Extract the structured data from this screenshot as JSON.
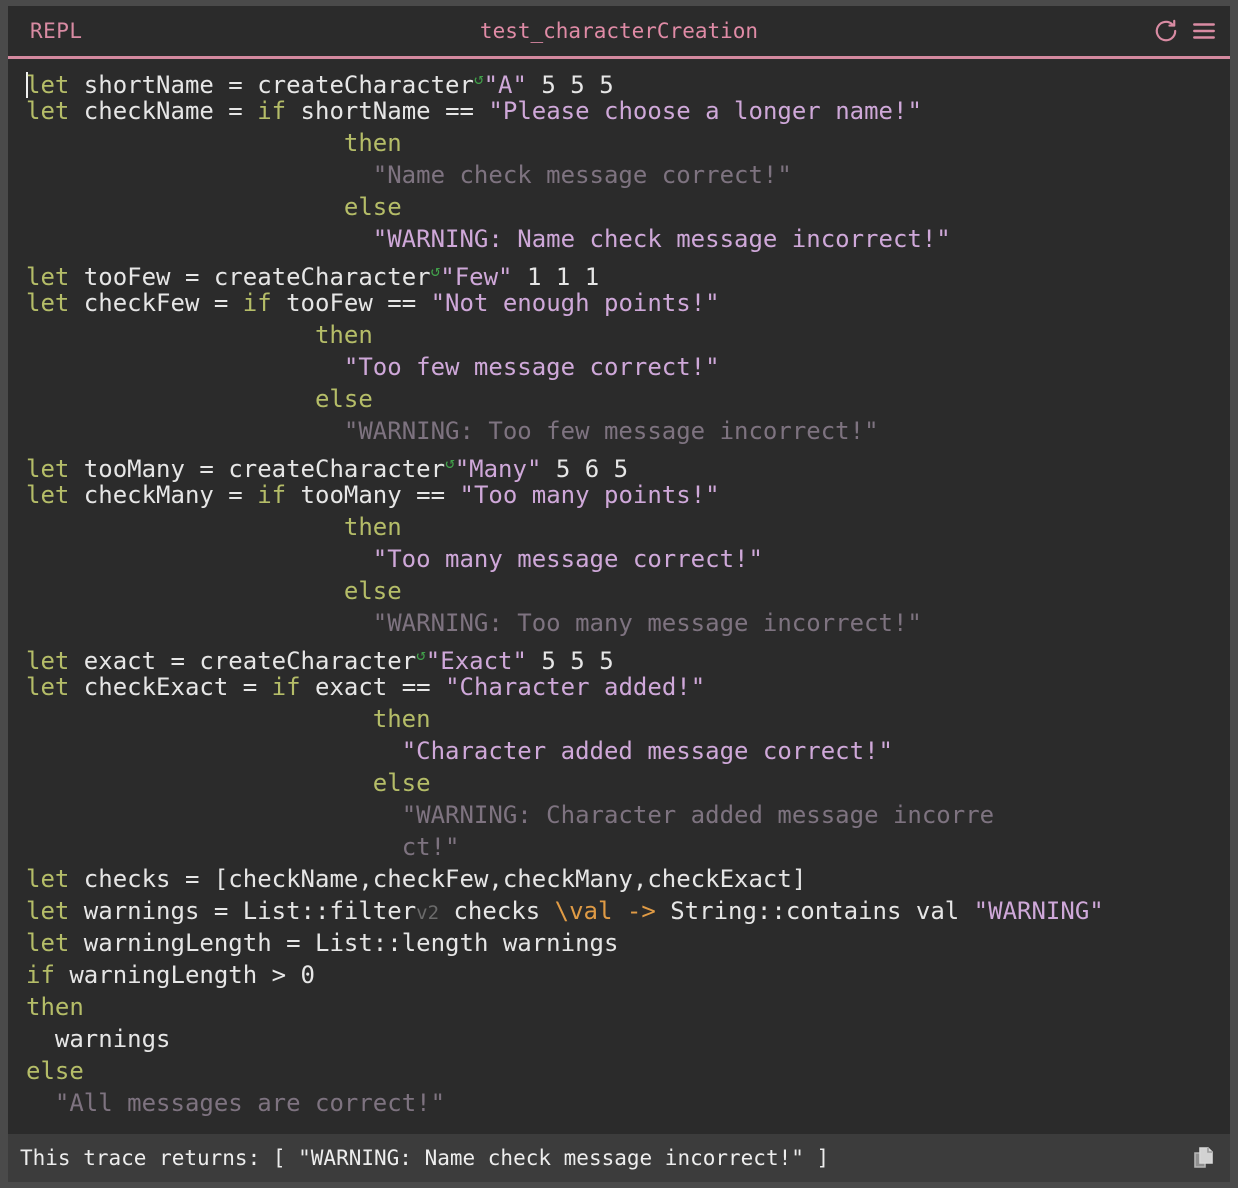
{
  "window": {
    "left_label": "REPL",
    "title": "test_characterCreation",
    "refresh_icon": "refresh-icon",
    "menu_icon": "hamburger-menu-icon",
    "accent_color": "#d98ba3",
    "background_color": "#2b2b2b",
    "frame_color": "#4a4a4a"
  },
  "editor": {
    "language": "roc",
    "caret_visible": true,
    "lines": [
      {
        "indent": 0,
        "tokens": [
          {
            "t": "caret"
          },
          {
            "t": "kw",
            "v": "let"
          },
          {
            "t": "id",
            "v": " shortName = "
          },
          {
            "t": "id",
            "v": "createCharacter"
          },
          {
            "t": "marker",
            "v": "↺"
          },
          {
            "t": "str",
            "v": "\"A\""
          },
          {
            "t": "id",
            "v": " 5 5 5"
          }
        ]
      },
      {
        "indent": 0,
        "tokens": [
          {
            "t": "kw",
            "v": "let"
          },
          {
            "t": "id",
            "v": " checkName = "
          },
          {
            "t": "kw",
            "v": "if"
          },
          {
            "t": "id",
            "v": " shortName "
          },
          {
            "t": "id",
            "v": "=="
          },
          {
            "t": "id",
            "v": " "
          },
          {
            "t": "str",
            "v": "\"Please choose a longer name!\""
          }
        ]
      },
      {
        "indent": 11,
        "tokens": [
          {
            "t": "kw",
            "v": "then"
          }
        ]
      },
      {
        "indent": 12,
        "tokens": [
          {
            "t": "strdim",
            "v": "\"Name check message correct!\""
          }
        ]
      },
      {
        "indent": 11,
        "tokens": [
          {
            "t": "kw",
            "v": "else"
          }
        ]
      },
      {
        "indent": 12,
        "tokens": [
          {
            "t": "str",
            "v": "\"WARNING: Name check message incorrect!\""
          }
        ]
      },
      {
        "indent": 0,
        "tokens": [
          {
            "t": "kw",
            "v": "let"
          },
          {
            "t": "id",
            "v": " tooFew = "
          },
          {
            "t": "id",
            "v": "createCharacter"
          },
          {
            "t": "marker",
            "v": "↺"
          },
          {
            "t": "str",
            "v": "\"Few\""
          },
          {
            "t": "id",
            "v": " 1 1 1"
          }
        ]
      },
      {
        "indent": 0,
        "tokens": [
          {
            "t": "kw",
            "v": "let"
          },
          {
            "t": "id",
            "v": " checkFew = "
          },
          {
            "t": "kw",
            "v": "if"
          },
          {
            "t": "id",
            "v": " tooFew "
          },
          {
            "t": "id",
            "v": "=="
          },
          {
            "t": "id",
            "v": " "
          },
          {
            "t": "str",
            "v": "\"Not enough points!\""
          }
        ]
      },
      {
        "indent": 10,
        "tokens": [
          {
            "t": "kw",
            "v": "then"
          }
        ]
      },
      {
        "indent": 11,
        "tokens": [
          {
            "t": "str",
            "v": "\"Too few message correct!\""
          }
        ]
      },
      {
        "indent": 10,
        "tokens": [
          {
            "t": "kw",
            "v": "else"
          }
        ]
      },
      {
        "indent": 11,
        "tokens": [
          {
            "t": "strdim",
            "v": "\"WARNING: Too few message incorrect!\""
          }
        ]
      },
      {
        "indent": 0,
        "tokens": [
          {
            "t": "kw",
            "v": "let"
          },
          {
            "t": "id",
            "v": " tooMany = "
          },
          {
            "t": "id",
            "v": "createCharacter"
          },
          {
            "t": "marker",
            "v": "↺"
          },
          {
            "t": "str",
            "v": "\"Many\""
          },
          {
            "t": "id",
            "v": " 5 6 5"
          }
        ]
      },
      {
        "indent": 0,
        "tokens": [
          {
            "t": "kw",
            "v": "let"
          },
          {
            "t": "id",
            "v": " checkMany = "
          },
          {
            "t": "kw",
            "v": "if"
          },
          {
            "t": "id",
            "v": " tooMany "
          },
          {
            "t": "id",
            "v": "=="
          },
          {
            "t": "id",
            "v": " "
          },
          {
            "t": "str",
            "v": "\"Too many points!\""
          }
        ]
      },
      {
        "indent": 11,
        "tokens": [
          {
            "t": "kw",
            "v": "then"
          }
        ]
      },
      {
        "indent": 12,
        "tokens": [
          {
            "t": "str",
            "v": "\"Too many message correct!\""
          }
        ]
      },
      {
        "indent": 11,
        "tokens": [
          {
            "t": "kw",
            "v": "else"
          }
        ]
      },
      {
        "indent": 12,
        "tokens": [
          {
            "t": "strdim",
            "v": "\"WARNING: Too many message incorrect!\""
          }
        ]
      },
      {
        "indent": 0,
        "tokens": [
          {
            "t": "kw",
            "v": "let"
          },
          {
            "t": "id",
            "v": " exact = "
          },
          {
            "t": "id",
            "v": "createCharacter"
          },
          {
            "t": "marker",
            "v": "↺"
          },
          {
            "t": "str",
            "v": "\"Exact\""
          },
          {
            "t": "id",
            "v": " 5 5 5"
          }
        ]
      },
      {
        "indent": 0,
        "tokens": [
          {
            "t": "kw",
            "v": "let"
          },
          {
            "t": "id",
            "v": " checkExact = "
          },
          {
            "t": "kw",
            "v": "if"
          },
          {
            "t": "id",
            "v": " exact "
          },
          {
            "t": "id",
            "v": "=="
          },
          {
            "t": "id",
            "v": " "
          },
          {
            "t": "str",
            "v": "\"Character added!\""
          }
        ]
      },
      {
        "indent": 12,
        "tokens": [
          {
            "t": "kw",
            "v": "then"
          }
        ]
      },
      {
        "indent": 13,
        "tokens": [
          {
            "t": "str",
            "v": "\"Character added message correct!\""
          }
        ]
      },
      {
        "indent": 12,
        "tokens": [
          {
            "t": "kw",
            "v": "else"
          }
        ]
      },
      {
        "indent": 13,
        "tokens": [
          {
            "t": "strdim",
            "v": "\"WARNING: Character added message incorre"
          }
        ]
      },
      {
        "indent": 13,
        "tokens": [
          {
            "t": "strdim",
            "v": "ct!\""
          }
        ]
      },
      {
        "indent": 0,
        "tokens": [
          {
            "t": "kw",
            "v": "let"
          },
          {
            "t": "id",
            "v": " checks = [checkName,checkFew,checkMany,checkExact]"
          }
        ]
      },
      {
        "indent": 0,
        "tokens": [
          {
            "t": "kw",
            "v": "let"
          },
          {
            "t": "id",
            "v": " warnings = List::filter"
          },
          {
            "t": "dim",
            "v": "v2"
          },
          {
            "t": "id",
            "v": " checks "
          },
          {
            "t": "orange",
            "v": "\\val ->"
          },
          {
            "t": "id",
            "v": " String::contains val "
          },
          {
            "t": "str",
            "v": "\"WARNING\""
          }
        ]
      },
      {
        "indent": 0,
        "tokens": [
          {
            "t": "kw",
            "v": "let"
          },
          {
            "t": "id",
            "v": " warningLength = List::length warnings"
          }
        ]
      },
      {
        "indent": 0,
        "tokens": [
          {
            "t": "kw",
            "v": "if"
          },
          {
            "t": "id",
            "v": " warningLength > 0"
          }
        ]
      },
      {
        "indent": 0,
        "tokens": [
          {
            "t": "kw",
            "v": "then"
          }
        ]
      },
      {
        "indent": 1,
        "tokens": [
          {
            "t": "id",
            "v": "warnings"
          }
        ]
      },
      {
        "indent": 0,
        "tokens": [
          {
            "t": "kw",
            "v": "else"
          }
        ]
      },
      {
        "indent": 1,
        "tokens": [
          {
            "t": "strdim",
            "v": "\"All messages are correct!\""
          }
        ]
      }
    ]
  },
  "status": {
    "label": "This trace returns: [ \"WARNING: Name check message incorrect!\" ]",
    "copy_icon": "copy-icon"
  }
}
